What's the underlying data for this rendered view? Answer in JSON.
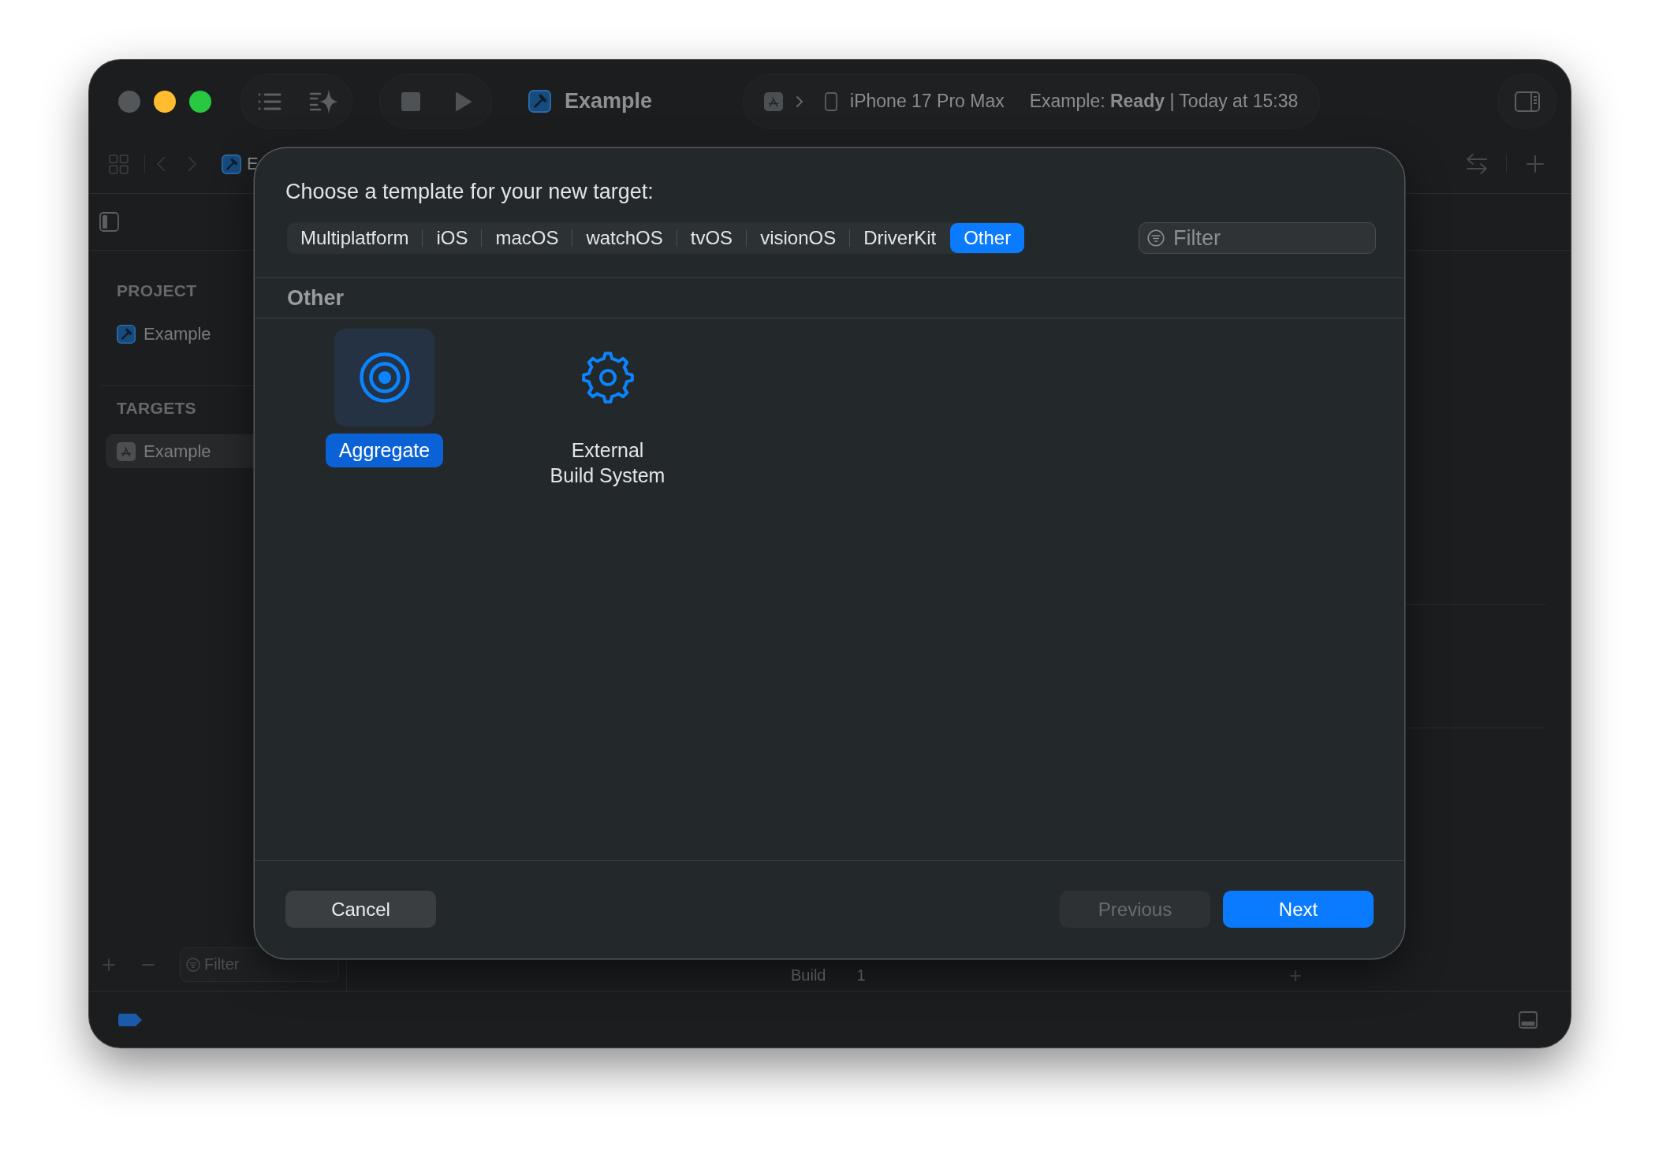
{
  "window": {
    "title": "Example",
    "traffic_lights": [
      {
        "kind": "close",
        "disabled": true
      },
      {
        "kind": "minimize",
        "disabled": false
      },
      {
        "kind": "zoom",
        "disabled": false
      }
    ]
  },
  "toolbar": {
    "device": "iPhone 17 Pro Max",
    "status": "Example: **Ready** | Today at 15:38"
  },
  "jump_bar": [
    {
      "label": "E"
    }
  ],
  "sidebar": {
    "sections": [
      {
        "heading": "PROJECT",
        "items": [
          {
            "label": "Example",
            "kind": "project",
            "selected": false
          }
        ]
      },
      {
        "heading": "TARGETS",
        "items": [
          {
            "label": "Example",
            "kind": "target",
            "selected": true
          }
        ]
      }
    ],
    "filter": {
      "placeholder": "Filter"
    }
  },
  "editor": {
    "rows": [
      {
        "label": "Build",
        "value": "1"
      }
    ]
  },
  "dialog": {
    "title": "Choose a template for your new target:",
    "tabs": [
      {
        "label": "Multiplatform",
        "selected": false
      },
      {
        "label": "iOS",
        "selected": false
      },
      {
        "label": "macOS",
        "selected": false
      },
      {
        "label": "watchOS",
        "selected": false
      },
      {
        "label": "tvOS",
        "selected": false
      },
      {
        "label": "visionOS",
        "selected": false
      },
      {
        "label": "DriverKit",
        "selected": false
      },
      {
        "label": "Other",
        "selected": true
      }
    ],
    "filter": {
      "placeholder": "Filter"
    },
    "section": "Other",
    "templates": [
      {
        "label": "Aggregate",
        "kind": "aggregate",
        "selected": true
      },
      {
        "label": "External Build System",
        "kind": "external",
        "selected": false
      }
    ],
    "buttons": [
      {
        "label": "Cancel",
        "kind": "cancel",
        "disabled": false
      },
      {
        "label": "Previous",
        "kind": "previous",
        "disabled": true
      },
      {
        "label": "Next",
        "kind": "next",
        "disabled": false
      }
    ]
  }
}
